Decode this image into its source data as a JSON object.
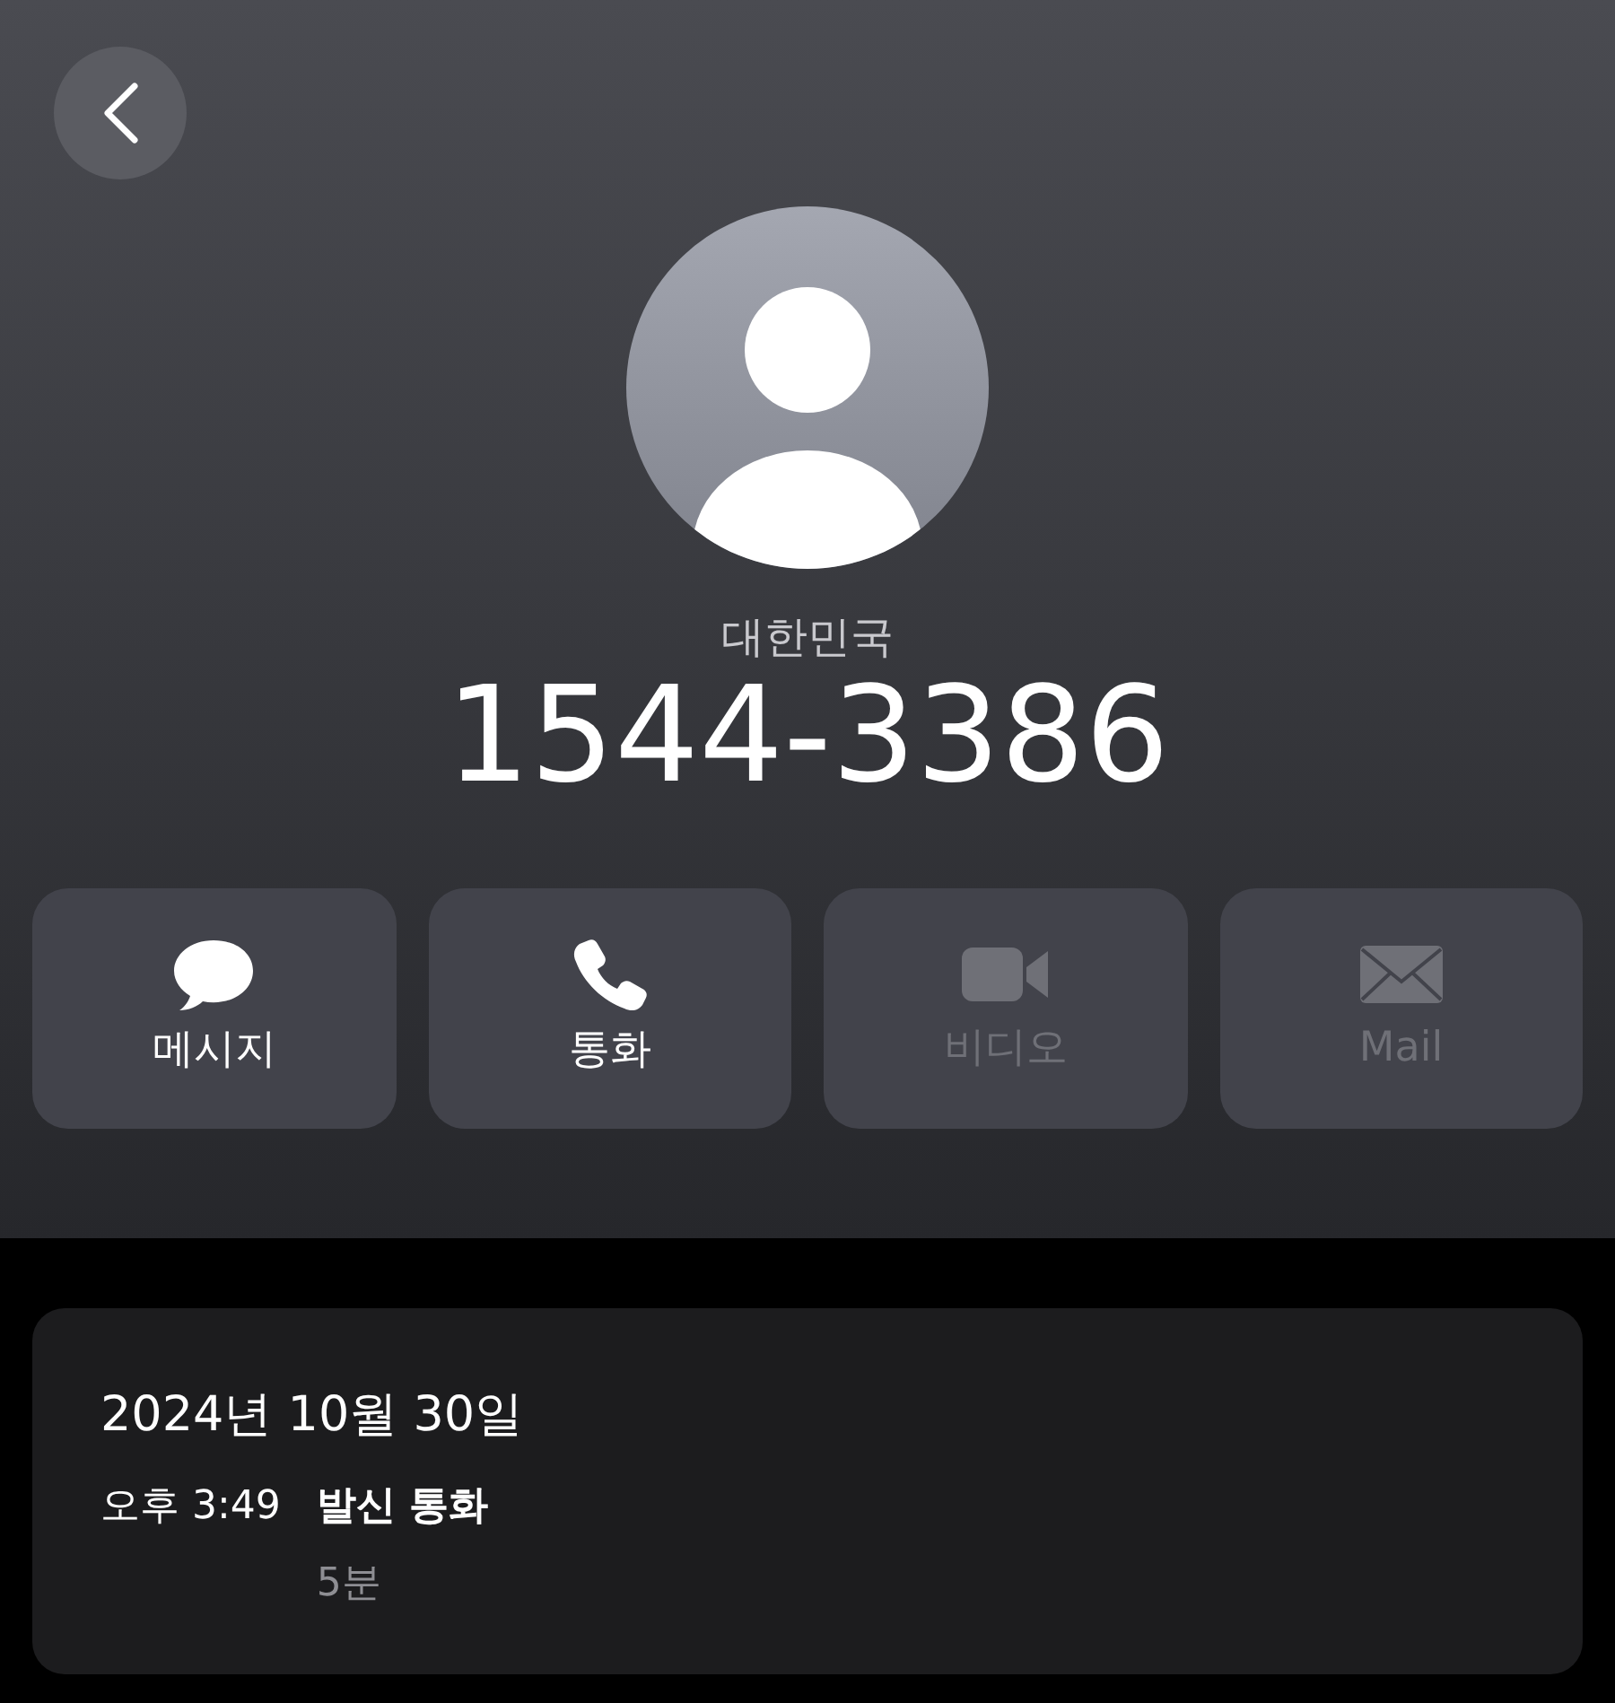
{
  "region": "대한민국",
  "number": "1544-3386",
  "actions": [
    {
      "kind": "message",
      "label": "메시지",
      "disabled": false
    },
    {
      "kind": "call",
      "label": "통화",
      "disabled": false
    },
    {
      "kind": "video",
      "label": "비디오",
      "disabled": true
    },
    {
      "kind": "mail",
      "label": "Mail",
      "disabled": true
    }
  ],
  "history": {
    "date": "2024년 10월 30일",
    "entries": [
      {
        "time": "오후 3:49",
        "type": "발신 통화",
        "duration": "5분"
      }
    ]
  }
}
